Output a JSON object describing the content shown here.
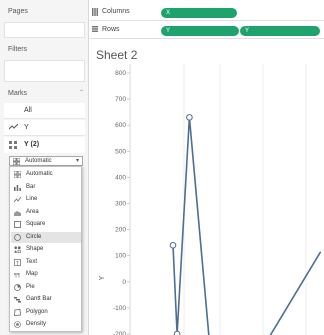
{
  "cards": {
    "pages": "Pages",
    "filters": "Filters",
    "marks": "Marks",
    "marks_all": "All",
    "marks_y": "Y",
    "marks_y2": "Y (2)",
    "mark_type_selected": "Automatic"
  },
  "shelves": {
    "columns_label": "Columns",
    "rows_label": "Rows",
    "columns_pills": [
      "X"
    ],
    "rows_pills": [
      "Y",
      "Y"
    ]
  },
  "sheet": {
    "title": "Sheet 2"
  },
  "mark_type_menu": [
    {
      "label": "Automatic",
      "icon": "automatic-icon"
    },
    {
      "label": "Bar",
      "icon": "bar-icon"
    },
    {
      "label": "Line",
      "icon": "line-icon"
    },
    {
      "label": "Area",
      "icon": "area-icon"
    },
    {
      "label": "Square",
      "icon": "square-icon"
    },
    {
      "label": "Circle",
      "icon": "circle-icon",
      "highlighted": true
    },
    {
      "label": "Shape",
      "icon": "shape-icon"
    },
    {
      "label": "Text",
      "icon": "text-icon"
    },
    {
      "label": "Map",
      "icon": "map-icon"
    },
    {
      "label": "Pie",
      "icon": "pie-icon"
    },
    {
      "label": "Gantt Bar",
      "icon": "gantt-bar-icon"
    },
    {
      "label": "Polygon",
      "icon": "polygon-icon"
    },
    {
      "label": "Density",
      "icon": "density-icon"
    }
  ],
  "colors": {
    "pill": "#1fa36c",
    "line": "#4e6d94",
    "grid": "#e6e6e6"
  },
  "chart_data": {
    "type": "line",
    "ylabel": "Y",
    "ylim": [
      -200,
      800
    ],
    "yticks": [
      800,
      700,
      600,
      500,
      400,
      300,
      200,
      100,
      0,
      -100,
      -200
    ],
    "points": [
      {
        "x": 0,
        "y": 140
      },
      {
        "x": 1,
        "y": -200
      },
      {
        "x": 4,
        "y": 630
      },
      {
        "x": 9,
        "y": -250
      },
      {
        "x": 22,
        "y": -250
      },
      {
        "x": 36,
        "y": 115
      }
    ],
    "marked_points": [
      0,
      1,
      2
    ]
  }
}
